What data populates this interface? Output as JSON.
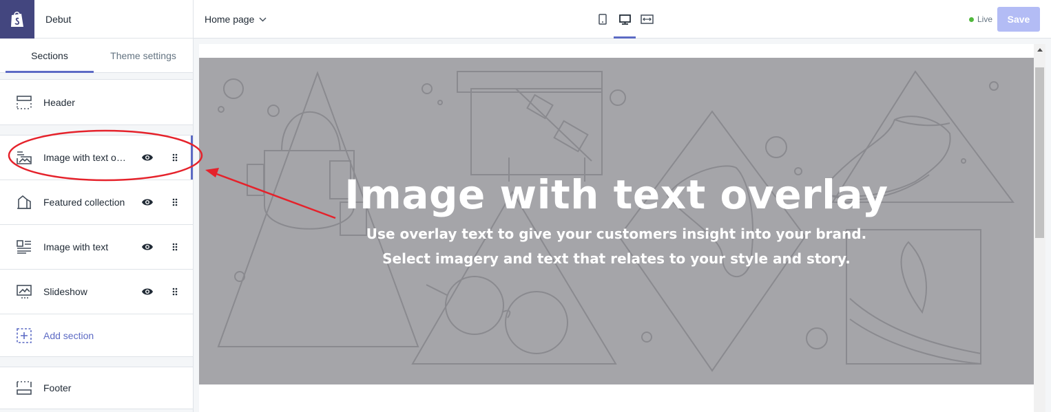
{
  "theme": {
    "name": "Debut"
  },
  "tabs": [
    {
      "label": "Sections",
      "active": true
    },
    {
      "label": "Theme settings",
      "active": false
    }
  ],
  "sections": {
    "header": {
      "label": "Header",
      "icon": "header-layout-icon"
    },
    "items": [
      {
        "label": "Image with text overlay",
        "icon": "image-overlay-icon",
        "selected": true
      },
      {
        "label": "Featured collection",
        "icon": "collection-icon",
        "selected": false
      },
      {
        "label": "Image with text",
        "icon": "image-text-icon",
        "selected": false
      },
      {
        "label": "Slideshow",
        "icon": "slideshow-icon",
        "selected": false
      }
    ],
    "add_label": "Add section",
    "footer": {
      "label": "Footer",
      "icon": "footer-layout-icon"
    }
  },
  "topbar": {
    "page": "Home page",
    "devices": [
      "mobile-icon",
      "desktop-icon",
      "fullscreen-icon"
    ],
    "active_device": "desktop",
    "status": "Live",
    "save_label": "Save"
  },
  "preview": {
    "title": "Image with text overlay",
    "subtitle_line1": "Use overlay text to give your customers insight into your brand.",
    "subtitle_line2": "Select imagery and text that relates to your style and story."
  },
  "colors": {
    "accent": "#5c6ac4",
    "logo_bg": "#43467f",
    "hero_bg": "#a5a5a9",
    "live": "#50b83c",
    "annotation": "#e5222b"
  }
}
